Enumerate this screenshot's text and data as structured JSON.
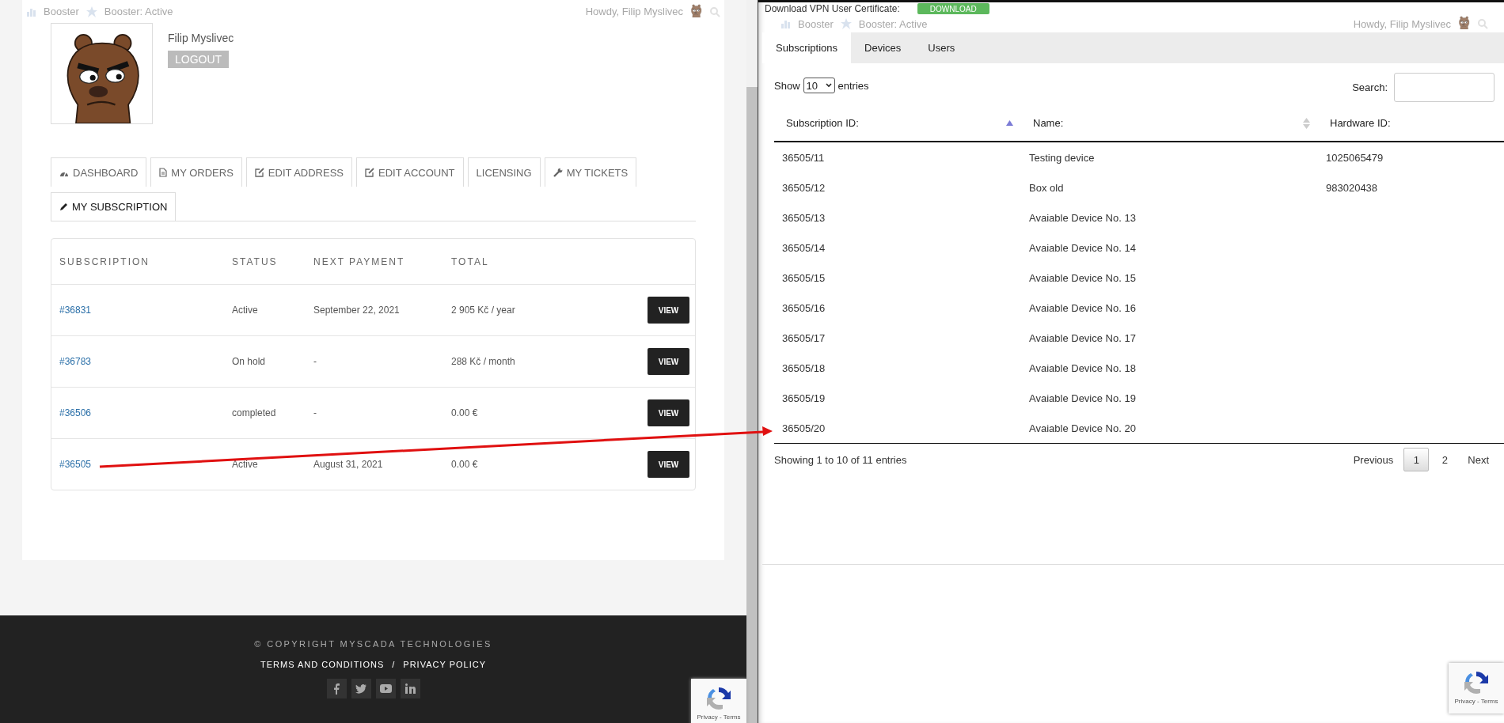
{
  "left_page": {
    "admin_bar": {
      "items": [
        "Booster",
        "Booster: Active"
      ],
      "greeting": "Howdy, Filip Myslivec"
    },
    "profile": {
      "name": "Filip Myslivec",
      "logout": "LOGOUT"
    },
    "tabs": [
      {
        "label": "DASHBOARD",
        "selected": false
      },
      {
        "label": "MY ORDERS",
        "selected": false
      },
      {
        "label": "EDIT ADDRESS",
        "selected": false
      },
      {
        "label": "EDIT ACCOUNT",
        "selected": false
      },
      {
        "label": "LICENSING",
        "selected": false
      },
      {
        "label": "MY TICKETS",
        "selected": false
      },
      {
        "label": "MY SUBSCRIPTION",
        "selected": true
      }
    ],
    "subscriptions_table": {
      "columns": [
        "SUBSCRIPTION",
        "STATUS",
        "NEXT PAYMENT",
        "TOTAL"
      ],
      "rows": [
        {
          "id": "#36831",
          "status": "Active",
          "next_payment": "September 22, 2021",
          "total": "2 905 Kč / year",
          "action": "VIEW"
        },
        {
          "id": "#36783",
          "status": "On hold",
          "next_payment": "-",
          "total": "288 Kč / month",
          "action": "VIEW"
        },
        {
          "id": "#36506",
          "status": "completed",
          "next_payment": "-",
          "total": "0.00 €",
          "action": "VIEW"
        },
        {
          "id": "#36505",
          "status": "Active",
          "next_payment": "August 31, 2021",
          "total": "0.00 €",
          "action": "VIEW"
        }
      ]
    },
    "footer": {
      "copyright": "© COPYRIGHT MYSCADA TECHNOLOGIES",
      "links": [
        "TERMS AND CONDITIONS",
        "PRIVACY POLICY"
      ],
      "separator": "/"
    },
    "recaptcha": {
      "text": "Privacy - Terms"
    }
  },
  "right_page": {
    "top_strip": {
      "label": "Download VPN User Certificate:",
      "button": "DOWNLOAD"
    },
    "admin_bar": {
      "items": [
        "Booster",
        "Booster: Active"
      ],
      "greeting": "Howdy, Filip Myslivec"
    },
    "tabs": [
      {
        "label": "Subscriptions",
        "selected": true
      },
      {
        "label": "Devices",
        "selected": false
      },
      {
        "label": "Users",
        "selected": false
      }
    ],
    "length_menu": {
      "before": "Show",
      "value": "10",
      "after": "entries"
    },
    "search": {
      "label": "Search:"
    },
    "table": {
      "columns": [
        {
          "label": "Subscription ID:",
          "sortable": true,
          "sorted": true
        },
        {
          "label": "Name:",
          "sortable": true,
          "sorted": false
        },
        {
          "label": "Hardware ID:",
          "sortable": false
        }
      ],
      "rows": [
        {
          "subscription_id": "36505/11",
          "name": "Testing device",
          "hardware_id": "1025065479"
        },
        {
          "subscription_id": "36505/12",
          "name": "Box old",
          "hardware_id": "983020438"
        },
        {
          "subscription_id": "36505/13",
          "name": "Avaiable Device No. 13"
        },
        {
          "subscription_id": "36505/14",
          "name": "Avaiable Device No. 14"
        },
        {
          "subscription_id": "36505/15",
          "name": "Avaiable Device No. 15"
        },
        {
          "subscription_id": "36505/16",
          "name": "Avaiable Device No. 16"
        },
        {
          "subscription_id": "36505/17",
          "name": "Avaiable Device No. 17"
        },
        {
          "subscription_id": "36505/18",
          "name": "Avaiable Device No. 18"
        },
        {
          "subscription_id": "36505/19",
          "name": "Avaiable Device No. 19"
        },
        {
          "subscription_id": "36505/20",
          "name": "Avaiable Device No. 20"
        }
      ]
    },
    "info": "Showing 1 to 10 of 11 entries",
    "pagination": [
      {
        "label": "Previous",
        "selected": false
      },
      {
        "label": "1",
        "selected": true
      },
      {
        "label": "2",
        "selected": false
      },
      {
        "label": "Next",
        "selected": false
      }
    ],
    "recaptcha": {
      "text": "Privacy - Terms"
    }
  }
}
